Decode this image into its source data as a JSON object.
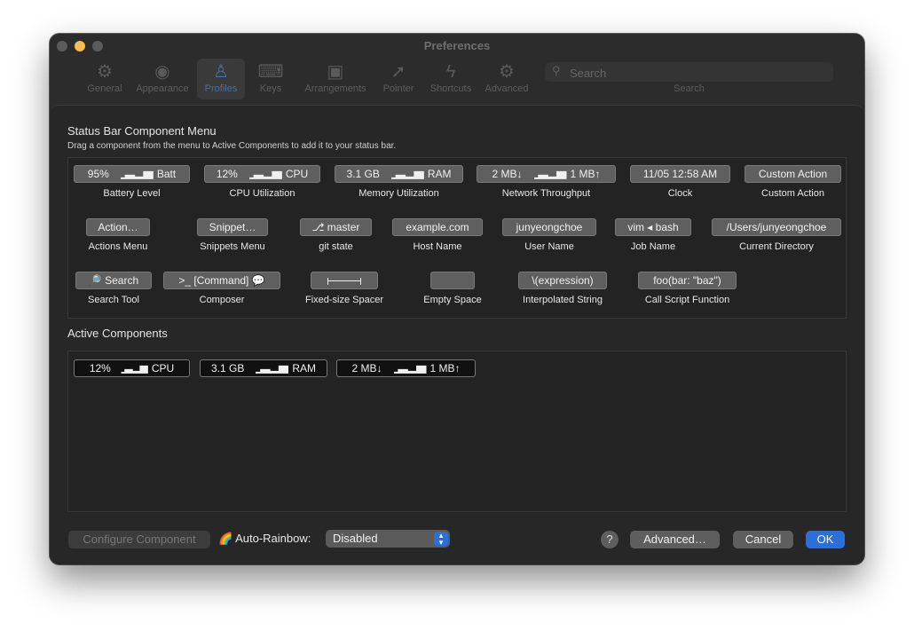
{
  "window": {
    "title": "Preferences"
  },
  "toolbar": {
    "items": [
      {
        "label": "General",
        "icon": "gear-icon"
      },
      {
        "label": "Appearance",
        "icon": "eye-icon"
      },
      {
        "label": "Profiles",
        "icon": "person-icon"
      },
      {
        "label": "Keys",
        "icon": "keyboard-icon"
      },
      {
        "label": "Arrangements",
        "icon": "windows-icon"
      },
      {
        "label": "Pointer",
        "icon": "pointer-icon"
      },
      {
        "label": "Shortcuts",
        "icon": "lightning-icon"
      },
      {
        "label": "Advanced",
        "icon": "gears-icon"
      }
    ],
    "selected": "Profiles",
    "search_placeholder": "Search",
    "search_caption": "Search"
  },
  "menu": {
    "title": "Status Bar Component Menu",
    "subtitle": "Drag a component from the menu to Active Components to add it to your status bar.",
    "components": [
      {
        "chip_prefix": "95%",
        "chip_suffix": "Batt",
        "label": "Battery Level"
      },
      {
        "chip_prefix": "12%",
        "chip_suffix": "CPU",
        "label": "CPU Utilization"
      },
      {
        "chip_prefix": "3.1 GB",
        "chip_suffix": "RAM",
        "label": "Memory Utilization"
      },
      {
        "chip_prefix": "2 MB↓",
        "chip_suffix": "1 MB↑",
        "label": "Network Throughput"
      },
      {
        "chip": "11/05 12:58 AM",
        "label": "Clock"
      },
      {
        "chip": "Custom Action",
        "label": "Custom Action"
      },
      {
        "chip": "Action…",
        "label": "Actions Menu"
      },
      {
        "chip": "Snippet…",
        "label": "Snippets Menu"
      },
      {
        "chip": "⎇ master",
        "label": "git state"
      },
      {
        "chip": "example.com",
        "label": "Host Name"
      },
      {
        "chip": "junyeongchoe",
        "label": "User Name"
      },
      {
        "chip": "vim ◂ bash",
        "label": "Job Name"
      },
      {
        "chip": "/Users/junyeongchoe",
        "label": "Current Directory"
      },
      {
        "chip": "🔎 Search",
        "label": "Search Tool"
      },
      {
        "chip": ">_ [Command] 💬",
        "label": "Composer"
      },
      {
        "chip": "",
        "label": "Fixed-size Spacer"
      },
      {
        "chip": "",
        "label": "Empty Space"
      },
      {
        "chip": "\\(expression)",
        "label": "Interpolated String"
      },
      {
        "chip": "foo(bar: \"baz\")",
        "label": "Call Script Function"
      }
    ]
  },
  "active": {
    "title": "Active Components",
    "components": [
      {
        "chip_prefix": "12%",
        "chip_suffix": "CPU"
      },
      {
        "chip_prefix": "3.1 GB",
        "chip_suffix": "RAM"
      },
      {
        "chip_prefix": "2 MB↓",
        "chip_suffix": "1 MB↑"
      }
    ]
  },
  "footer": {
    "configure_label": "Configure Component",
    "rainbow_emoji": "🌈",
    "rainbow_label": "Auto-Rainbow:",
    "rainbow_value": "Disabled",
    "help_label": "?",
    "advanced_label": "Advanced…",
    "cancel_label": "Cancel",
    "ok_label": "OK"
  }
}
